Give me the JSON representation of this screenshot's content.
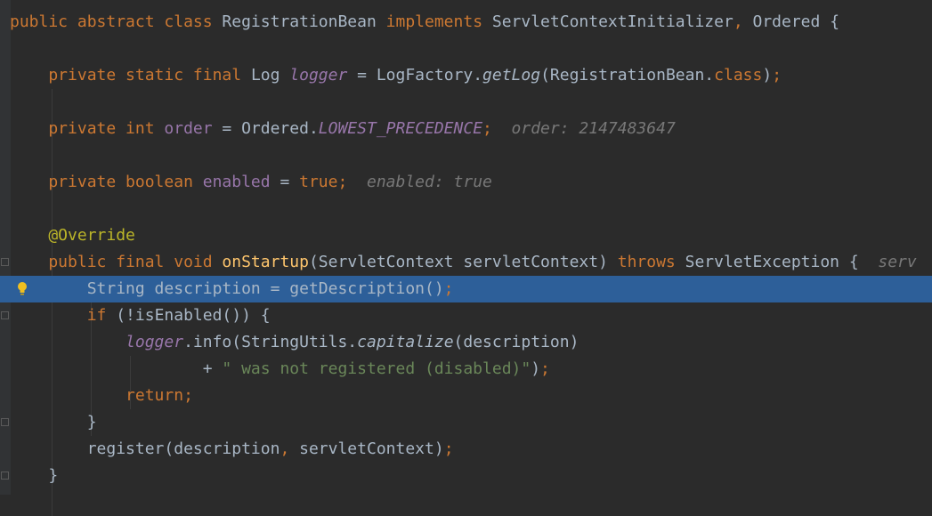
{
  "editor": {
    "lines": [
      {
        "id": "l1",
        "tokens": [
          {
            "t": "public abstract class ",
            "c": "kw"
          },
          {
            "t": "RegistrationBean ",
            "c": "plain"
          },
          {
            "t": "implements ",
            "c": "kw"
          },
          {
            "t": "ServletContextInitializer",
            "c": "plain"
          },
          {
            "t": ", ",
            "c": "kw"
          },
          {
            "t": "Ordered {",
            "c": "plain"
          }
        ]
      },
      {
        "id": "l2",
        "tokens": []
      },
      {
        "id": "l3",
        "tokens": [
          {
            "t": "    private static final ",
            "c": "kw"
          },
          {
            "t": "Log ",
            "c": "plain"
          },
          {
            "t": "logger",
            "c": "ifield"
          },
          {
            "t": " = LogFactory.",
            "c": "plain"
          },
          {
            "t": "getLog",
            "c": "smeth"
          },
          {
            "t": "(RegistrationBean.",
            "c": "plain"
          },
          {
            "t": "class",
            "c": "kw"
          },
          {
            "t": ")",
            "c": "plain"
          },
          {
            "t": ";",
            "c": "kw"
          }
        ]
      },
      {
        "id": "l4",
        "tokens": []
      },
      {
        "id": "l5",
        "tokens": [
          {
            "t": "    private int ",
            "c": "kw"
          },
          {
            "t": "order",
            "c": "field"
          },
          {
            "t": " = Ordered.",
            "c": "plain"
          },
          {
            "t": "LOWEST_PRECEDENCE",
            "c": "ifield"
          },
          {
            "t": ";",
            "c": "kw"
          },
          {
            "t": "  order: 2147483647",
            "c": "hint"
          }
        ]
      },
      {
        "id": "l6",
        "tokens": []
      },
      {
        "id": "l7",
        "tokens": [
          {
            "t": "    private boolean ",
            "c": "kw"
          },
          {
            "t": "enabled",
            "c": "field"
          },
          {
            "t": " = ",
            "c": "plain"
          },
          {
            "t": "true",
            "c": "kw"
          },
          {
            "t": ";",
            "c": "kw"
          },
          {
            "t": "  enabled: true",
            "c": "hint"
          }
        ]
      },
      {
        "id": "l8",
        "tokens": []
      },
      {
        "id": "l9",
        "tokens": [
          {
            "t": "    @Override",
            "c": "ann"
          }
        ]
      },
      {
        "id": "l10",
        "tokens": [
          {
            "t": "    public final void ",
            "c": "kw"
          },
          {
            "t": "onStartup",
            "c": "meth-decl"
          },
          {
            "t": "(ServletContext servletContext) ",
            "c": "plain"
          },
          {
            "t": "throws ",
            "c": "kw"
          },
          {
            "t": "ServletException {",
            "c": "plain"
          },
          {
            "t": "  serv",
            "c": "hint"
          }
        ]
      },
      {
        "id": "l11",
        "current": true,
        "tokens": [
          {
            "t": "        String description = getDescription()",
            "c": "plain"
          },
          {
            "t": ";",
            "c": "kw"
          }
        ]
      },
      {
        "id": "l12",
        "tokens": [
          {
            "t": "        ",
            "c": "plain"
          },
          {
            "t": "if ",
            "c": "kw"
          },
          {
            "t": "(!isEnabled()) {",
            "c": "plain"
          }
        ]
      },
      {
        "id": "l13",
        "tokens": [
          {
            "t": "            ",
            "c": "plain"
          },
          {
            "t": "logger",
            "c": "ifield"
          },
          {
            "t": ".info(StringUtils.",
            "c": "plain"
          },
          {
            "t": "capitalize",
            "c": "smeth"
          },
          {
            "t": "(description)",
            "c": "plain"
          }
        ]
      },
      {
        "id": "l14",
        "tokens": [
          {
            "t": "                    + ",
            "c": "plain"
          },
          {
            "t": "\" was not registered (disabled)\"",
            "c": "str"
          },
          {
            "t": ")",
            "c": "plain"
          },
          {
            "t": ";",
            "c": "kw"
          }
        ]
      },
      {
        "id": "l15",
        "tokens": [
          {
            "t": "            ",
            "c": "plain"
          },
          {
            "t": "return",
            "c": "kw"
          },
          {
            "t": ";",
            "c": "kw"
          }
        ]
      },
      {
        "id": "l16",
        "tokens": [
          {
            "t": "        }",
            "c": "plain"
          }
        ]
      },
      {
        "id": "l17",
        "tokens": [
          {
            "t": "        register(description",
            "c": "plain"
          },
          {
            "t": ", ",
            "c": "kw"
          },
          {
            "t": "servletContext)",
            "c": "plain"
          },
          {
            "t": ";",
            "c": "kw"
          }
        ]
      },
      {
        "id": "l18",
        "tokens": [
          {
            "t": "    }",
            "c": "plain"
          }
        ]
      }
    ],
    "colors": {
      "background": "#2b2b2b",
      "current_line": "#2d5f99",
      "keyword": "#cc7832",
      "field": "#9876aa",
      "method_declaration": "#ffc66d",
      "annotation": "#bbb529",
      "string": "#6a8759",
      "inlay_hint": "#787878"
    },
    "icons": {
      "intention_bulb": "lightbulb-icon"
    }
  }
}
